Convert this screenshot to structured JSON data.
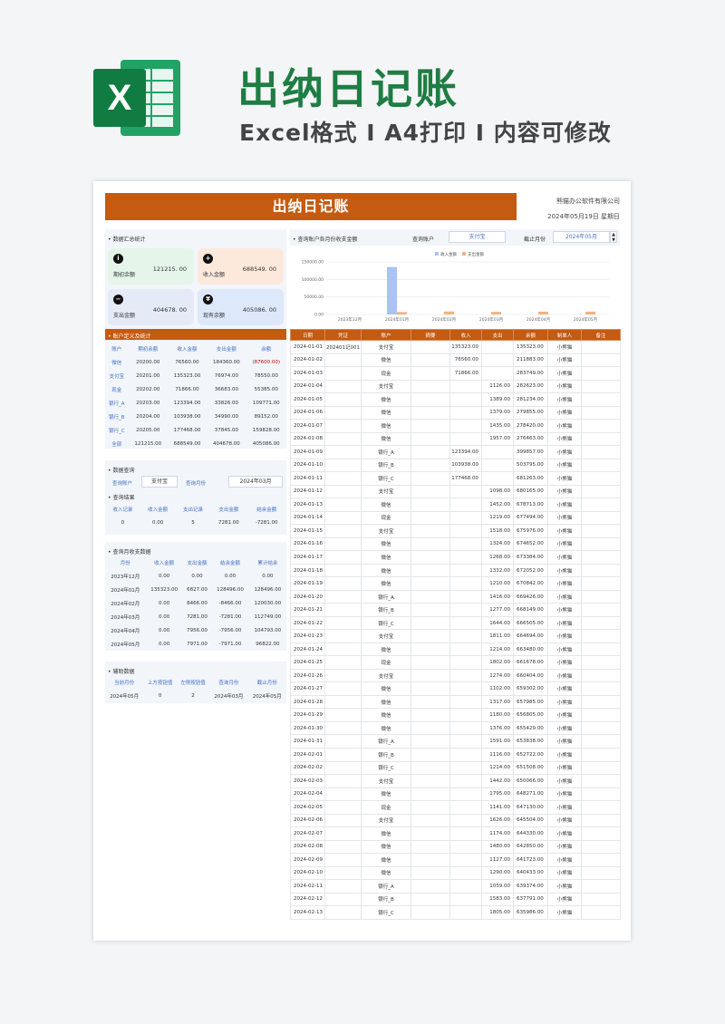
{
  "promo": {
    "title": "出纳日记账",
    "subtitle": "Excel格式 I A4打印 I 内容可修改"
  },
  "header": {
    "title": "出纳日记账",
    "company": "熊猫办公软件有限公司",
    "date": "2024年05月19日 星期日"
  },
  "summary": {
    "section_title": "数据汇总统计",
    "cards": [
      {
        "icon": "info-icon",
        "label": "期初余额",
        "value": "121215. 00",
        "color": "#e5f5e9"
      },
      {
        "icon": "plus-icon",
        "label": "收入金额",
        "value": "688549. 00",
        "color": "#fde9dc"
      },
      {
        "icon": "minus-icon",
        "label": "支出金额",
        "value": "404678. 00",
        "color": "#e4ebf7"
      },
      {
        "icon": "coin-icon",
        "label": "现有余额",
        "value": "405086. 00",
        "color": "#dde8fb"
      }
    ]
  },
  "account_def": {
    "section_title": "账户定义及统计",
    "headers": [
      "账户",
      "期初余额",
      "收入金额",
      "支出金额",
      "余额"
    ],
    "rows": [
      [
        "微信",
        "20200.00",
        "76560.00",
        "184360.00",
        "(87600.00)"
      ],
      [
        "支付宝",
        "20201.00",
        "135323.00",
        "76974.00",
        "78550.00"
      ],
      [
        "现金",
        "20202.00",
        "71866.00",
        "36683.00",
        "55385.00"
      ],
      [
        "银行_A",
        "20203.00",
        "123394.00",
        "33826.00",
        "109771.00"
      ],
      [
        "银行_B",
        "20204.00",
        "103938.00",
        "34990.00",
        "89152.00"
      ],
      [
        "银行_C",
        "20205.00",
        "177468.00",
        "37845.00",
        "159828.00"
      ],
      [
        "全部",
        "121215.00",
        "688549.00",
        "404678.00",
        "405086.00"
      ]
    ]
  },
  "query": {
    "section_title": "数据查询",
    "account_label": "查询账户",
    "account_value": "支付宝",
    "month_label": "查询月份",
    "month_value": "2024年03月",
    "result_title": "查询结果",
    "result_headers": [
      "收入记录",
      "收入金额",
      "支出记录",
      "支出金额",
      "结余金额"
    ],
    "result_values": [
      "0",
      "0.00",
      "5",
      "7281.00",
      "-7281.00"
    ]
  },
  "monthly": {
    "section_title": "查询月收支数据",
    "headers": [
      "月份",
      "收入金额",
      "支出金额",
      "结余金额",
      "累计结余"
    ],
    "rows": [
      [
        "2023年12月",
        "0.00",
        "0.00",
        "0.00",
        "0.00"
      ],
      [
        "2024年01月",
        "135323.00",
        "6827.00",
        "128496.00",
        "128496.00"
      ],
      [
        "2024年02月",
        "0.00",
        "8466.00",
        "-8466.00",
        "120030.00"
      ],
      [
        "2024年03月",
        "0.00",
        "7281.00",
        "-7281.00",
        "112749.00"
      ],
      [
        "2024年04月",
        "0.00",
        "7956.00",
        "-7956.00",
        "104793.00"
      ],
      [
        "2024年05月",
        "0.00",
        "7971.00",
        "-7971.00",
        "96822.00"
      ]
    ]
  },
  "aux": {
    "section_title": "辅助数据",
    "headers": [
      "当前月份",
      "上方按钮值",
      "左侧按钮值",
      "查询月份",
      "截止月份"
    ],
    "values": [
      "2024年05月",
      "0",
      "2",
      "2024年03月",
      "2024年05月"
    ]
  },
  "chart_panel": {
    "section_title": "查询账户各月份收支金额",
    "account_label": "查询账户",
    "account_value": "支付宝",
    "month_label": "截止月份",
    "month_value": "2024年05月"
  },
  "chart_data": {
    "type": "bar",
    "categories": [
      "2023年12月",
      "2024年01月",
      "2024年02月",
      "2024年03月",
      "2024年04月",
      "2024年05月"
    ],
    "series": [
      {
        "name": "收入金额",
        "color": "#a9c3f2",
        "values": [
          0,
          135323,
          0,
          0,
          0,
          0
        ]
      },
      {
        "name": "支出金额",
        "color": "#f4b183",
        "values": [
          0,
          6827,
          8466,
          7281,
          7956,
          7971
        ]
      }
    ],
    "ylim": [
      0,
      150000
    ],
    "yticks": [
      "0.00",
      "50000.00",
      "100000.00",
      "150000.00"
    ],
    "legend": "top",
    "grid": true
  },
  "ledger": {
    "headers": [
      "日期",
      "凭证",
      "账户",
      "摘要",
      "收入",
      "支出",
      "余额",
      "制单人",
      "备注"
    ],
    "rows": [
      [
        "2024-01-01",
        "202401记001",
        "支付宝",
        "",
        "135323.00",
        "",
        "135323.00",
        "小熊猫",
        ""
      ],
      [
        "2024-01-02",
        "",
        "微信",
        "",
        "76560.00",
        "",
        "211883.00",
        "小熊猫",
        ""
      ],
      [
        "2024-01-03",
        "",
        "现金",
        "",
        "71866.00",
        "",
        "283749.00",
        "小熊猫",
        ""
      ],
      [
        "2024-01-04",
        "",
        "支付宝",
        "",
        "",
        "1126.00",
        "282623.00",
        "小熊猫",
        ""
      ],
      [
        "2024-01-05",
        "",
        "微信",
        "",
        "",
        "1389.00",
        "281234.00",
        "小熊猫",
        ""
      ],
      [
        "2024-01-06",
        "",
        "微信",
        "",
        "",
        "1379.00",
        "279855.00",
        "小熊猫",
        ""
      ],
      [
        "2024-01-07",
        "",
        "微信",
        "",
        "",
        "1435.00",
        "278420.00",
        "小熊猫",
        ""
      ],
      [
        "2024-01-08",
        "",
        "微信",
        "",
        "",
        "1957.00",
        "276463.00",
        "小熊猫",
        ""
      ],
      [
        "2024-01-09",
        "",
        "银行_A",
        "",
        "123394.00",
        "",
        "399857.00",
        "小熊猫",
        ""
      ],
      [
        "2024-01-10",
        "",
        "银行_B",
        "",
        "103938.00",
        "",
        "503795.00",
        "小熊猫",
        ""
      ],
      [
        "2024-01-11",
        "",
        "银行_C",
        "",
        "177468.00",
        "",
        "681263.00",
        "小熊猫",
        ""
      ],
      [
        "2024-01-12",
        "",
        "支付宝",
        "",
        "",
        "1098.00",
        "680165.00",
        "小熊猫",
        ""
      ],
      [
        "2024-01-13",
        "",
        "微信",
        "",
        "",
        "1452.00",
        "678713.00",
        "小熊猫",
        ""
      ],
      [
        "2024-01-14",
        "",
        "现金",
        "",
        "",
        "1219.00",
        "677494.00",
        "小熊猫",
        ""
      ],
      [
        "2024-01-15",
        "",
        "支付宝",
        "",
        "",
        "1518.00",
        "675976.00",
        "小熊猫",
        ""
      ],
      [
        "2024-01-16",
        "",
        "微信",
        "",
        "",
        "1324.00",
        "674652.00",
        "小熊猫",
        ""
      ],
      [
        "2024-01-17",
        "",
        "微信",
        "",
        "",
        "1268.00",
        "673384.00",
        "小熊猫",
        ""
      ],
      [
        "2024-01-18",
        "",
        "微信",
        "",
        "",
        "1332.00",
        "672052.00",
        "小熊猫",
        ""
      ],
      [
        "2024-01-19",
        "",
        "微信",
        "",
        "",
        "1210.00",
        "670842.00",
        "小熊猫",
        ""
      ],
      [
        "2024-01-20",
        "",
        "银行_A",
        "",
        "",
        "1416.00",
        "669426.00",
        "小熊猫",
        ""
      ],
      [
        "2024-01-21",
        "",
        "银行_B",
        "",
        "",
        "1277.00",
        "668149.00",
        "小熊猫",
        ""
      ],
      [
        "2024-01-22",
        "",
        "银行_C",
        "",
        "",
        "1644.00",
        "666505.00",
        "小熊猫",
        ""
      ],
      [
        "2024-01-23",
        "",
        "支付宝",
        "",
        "",
        "1811.00",
        "664694.00",
        "小熊猫",
        ""
      ],
      [
        "2024-01-24",
        "",
        "微信",
        "",
        "",
        "1214.00",
        "663480.00",
        "小熊猫",
        ""
      ],
      [
        "2024-01-25",
        "",
        "现金",
        "",
        "",
        "1802.00",
        "661678.00",
        "小熊猫",
        ""
      ],
      [
        "2024-01-26",
        "",
        "支付宝",
        "",
        "",
        "1274.00",
        "660404.00",
        "小熊猫",
        ""
      ],
      [
        "2024-01-27",
        "",
        "微信",
        "",
        "",
        "1102.00",
        "659302.00",
        "小熊猫",
        ""
      ],
      [
        "2024-01-28",
        "",
        "微信",
        "",
        "",
        "1317.00",
        "657985.00",
        "小熊猫",
        ""
      ],
      [
        "2024-01-29",
        "",
        "微信",
        "",
        "",
        "1180.00",
        "656805.00",
        "小熊猫",
        ""
      ],
      [
        "2024-01-30",
        "",
        "微信",
        "",
        "",
        "1376.00",
        "655429.00",
        "小熊猫",
        ""
      ],
      [
        "2024-01-31",
        "",
        "银行_A",
        "",
        "",
        "1591.00",
        "653838.00",
        "小熊猫",
        ""
      ],
      [
        "2024-02-01",
        "",
        "银行_B",
        "",
        "",
        "1116.00",
        "652722.00",
        "小熊猫",
        ""
      ],
      [
        "2024-02-02",
        "",
        "银行_C",
        "",
        "",
        "1214.00",
        "651508.00",
        "小熊猫",
        ""
      ],
      [
        "2024-02-03",
        "",
        "支付宝",
        "",
        "",
        "1442.00",
        "650066.00",
        "小熊猫",
        ""
      ],
      [
        "2024-02-04",
        "",
        "微信",
        "",
        "",
        "1795.00",
        "648271.00",
        "小熊猫",
        ""
      ],
      [
        "2024-02-05",
        "",
        "现金",
        "",
        "",
        "1141.00",
        "647130.00",
        "小熊猫",
        ""
      ],
      [
        "2024-02-06",
        "",
        "支付宝",
        "",
        "",
        "1626.00",
        "645504.00",
        "小熊猫",
        ""
      ],
      [
        "2024-02-07",
        "",
        "微信",
        "",
        "",
        "1174.00",
        "644330.00",
        "小熊猫",
        ""
      ],
      [
        "2024-02-08",
        "",
        "微信",
        "",
        "",
        "1480.00",
        "642850.00",
        "小熊猫",
        ""
      ],
      [
        "2024-02-09",
        "",
        "微信",
        "",
        "",
        "1127.00",
        "641723.00",
        "小熊猫",
        ""
      ],
      [
        "2024-02-10",
        "",
        "微信",
        "",
        "",
        "1290.00",
        "640433.00",
        "小熊猫",
        ""
      ],
      [
        "2024-02-11",
        "",
        "银行_A",
        "",
        "",
        "1059.00",
        "639374.00",
        "小熊猫",
        ""
      ],
      [
        "2024-02-12",
        "",
        "银行_B",
        "",
        "",
        "1583.00",
        "637791.00",
        "小熊猫",
        ""
      ],
      [
        "2024-02-13",
        "",
        "银行_C",
        "",
        "",
        "1805.00",
        "635986.00",
        "小熊猫",
        ""
      ]
    ]
  }
}
